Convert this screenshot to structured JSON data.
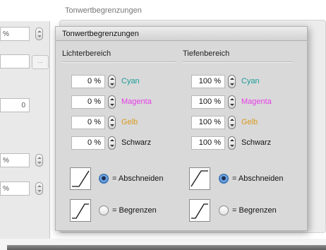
{
  "background": {
    "header": "Tonwertbegrenzungen",
    "fields": [
      "%",
      "",
      "0",
      "%",
      "%"
    ],
    "more_button": "..."
  },
  "panel": {
    "title": "Tonwertbegrenzungen",
    "highlights": {
      "label": "Lichterbereich",
      "rows": [
        {
          "value": "0 %",
          "channel": "Cyan",
          "color": "#1d9a9a"
        },
        {
          "value": "0 %",
          "channel": "Magenta",
          "color": "#e63ce6"
        },
        {
          "value": "0 %",
          "channel": "Gelb",
          "color": "#d99a1c"
        },
        {
          "value": "0 %",
          "channel": "Schwarz",
          "color": "#111111"
        }
      ],
      "options": [
        {
          "label": "= Abschneiden",
          "selected": true
        },
        {
          "label": "= Begrenzen",
          "selected": false
        }
      ]
    },
    "shadows": {
      "label": "Tiefenbereich",
      "rows": [
        {
          "value": "100 %",
          "channel": "Cyan",
          "color": "#1d9a9a"
        },
        {
          "value": "100 %",
          "channel": "Magenta",
          "color": "#e63ce6"
        },
        {
          "value": "100 %",
          "channel": "Gelb",
          "color": "#d99a1c"
        },
        {
          "value": "100 %",
          "channel": "Schwarz",
          "color": "#111111"
        }
      ],
      "options": [
        {
          "label": "= Abschneiden",
          "selected": true
        },
        {
          "label": "= Begrenzen",
          "selected": false
        }
      ]
    }
  }
}
